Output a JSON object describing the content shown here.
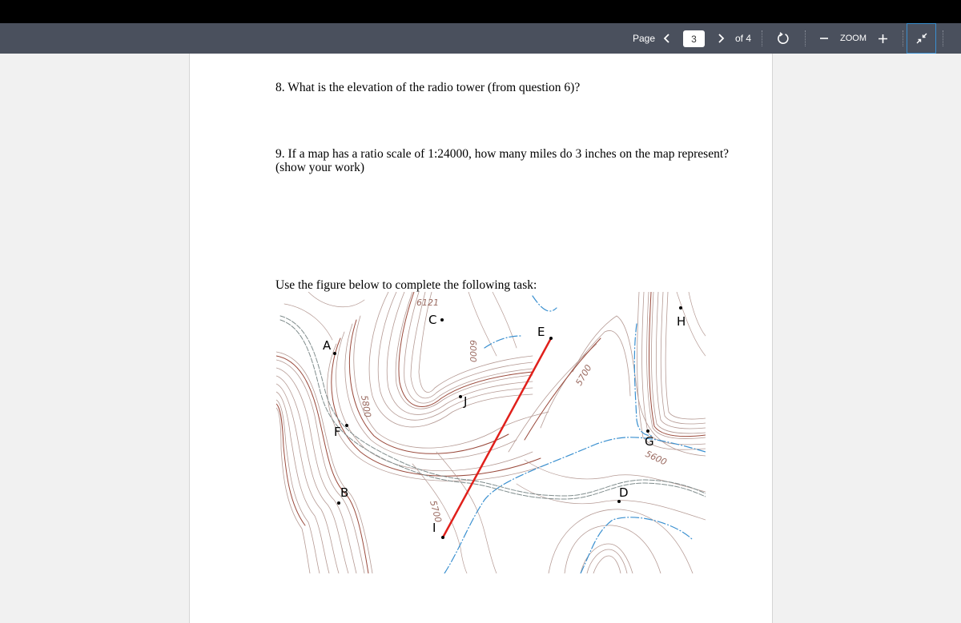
{
  "toolbar": {
    "page_label": "Page",
    "current_page": "3",
    "of_label": "of 4",
    "zoom_label": "ZOOM",
    "icons": {
      "prev": "chevron-left-icon",
      "next": "chevron-right-icon",
      "rotate": "rotate-icon",
      "zoom_out": "minus-icon",
      "zoom_in": "plus-icon",
      "fit": "collapse-icon"
    }
  },
  "document": {
    "q8": "8. What is the elevation of the radio tower (from question 6)?",
    "q9_line1": "9. If a map has a ratio scale of 1:24000, how many miles do 3 inches on the map represent?",
    "q9_line2": "(show your work)",
    "task_instruction": "Use the figure below to complete the following task:"
  },
  "map": {
    "points": [
      {
        "label": "A"
      },
      {
        "label": "B"
      },
      {
        "label": "C"
      },
      {
        "label": "D"
      },
      {
        "label": "E"
      },
      {
        "label": "F"
      },
      {
        "label": "G"
      },
      {
        "label": "H"
      },
      {
        "label": "I"
      },
      {
        "label": "J"
      }
    ],
    "elevation_labels": [
      "6121",
      "6000",
      "5800",
      "5700",
      "5700",
      "5600"
    ],
    "profile_line": {
      "from": "I",
      "to": "E",
      "color": "#e0201b"
    },
    "colors": {
      "contour": "#b59a94",
      "index_contour": "#9a4a3c",
      "stream": "#3a90d0",
      "road": "#7f8c8c"
    }
  }
}
